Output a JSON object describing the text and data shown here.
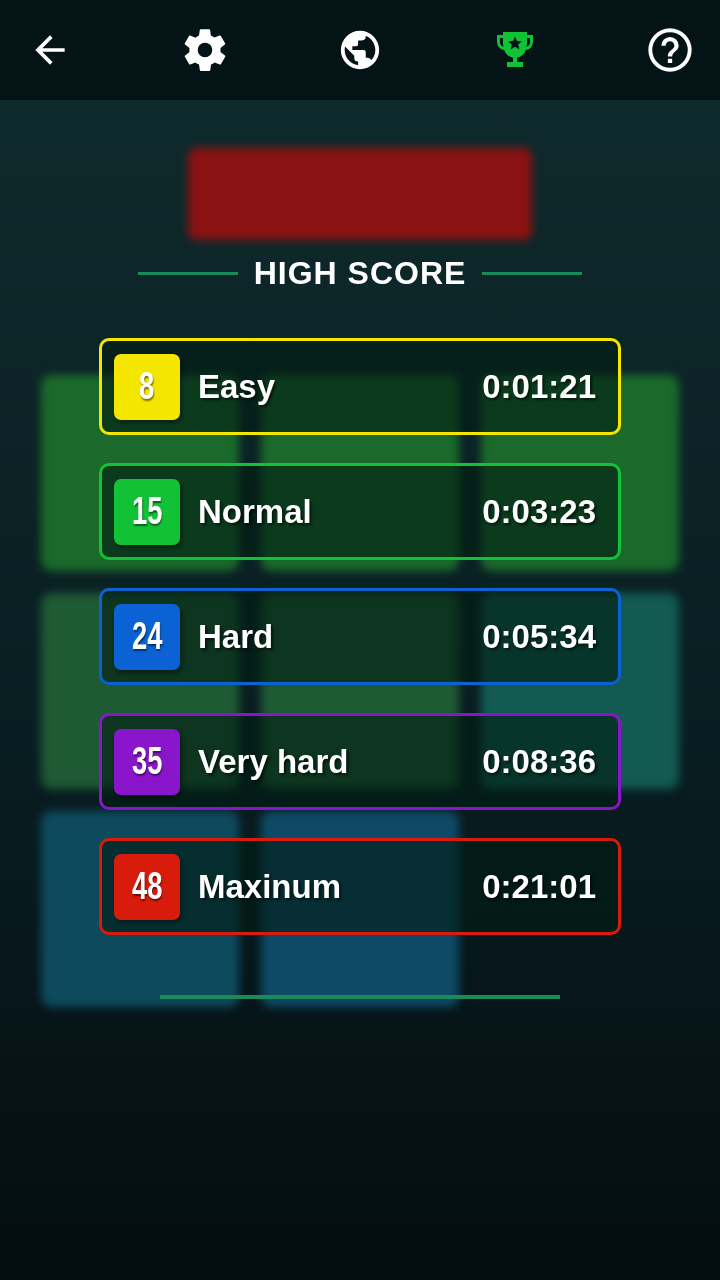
{
  "toolbar": [
    {
      "kind": "back",
      "selected": false
    },
    {
      "kind": "settings",
      "selected": false
    },
    {
      "kind": "globe",
      "selected": false
    },
    {
      "kind": "trophy",
      "selected": true
    },
    {
      "kind": "help",
      "selected": false
    }
  ],
  "background": {
    "tiles": [
      {
        "color": "#1b6a2c"
      },
      {
        "color": "#1b6a2c"
      },
      {
        "color": "#1b6a2c"
      },
      {
        "color": "#1e5a34"
      },
      {
        "color": "#1e5a34"
      },
      {
        "color": "#135a52"
      },
      {
        "color": "#0e4a5e"
      },
      {
        "color": "#0e4a66"
      }
    ]
  },
  "high_score": {
    "title": "HIGH SCORE",
    "rows": [
      {
        "count": "8",
        "level": "Easy",
        "time": "0:01:21",
        "color": "#f5e600"
      },
      {
        "count": "15",
        "level": "Normal",
        "time": "0:03:23",
        "color": "#12c236"
      },
      {
        "count": "24",
        "level": "Hard",
        "time": "0:05:34",
        "color": "#0a62d4"
      },
      {
        "count": "35",
        "level": "Very hard",
        "time": "0:08:36",
        "color": "#8a16cc"
      },
      {
        "count": "48",
        "level": "Maxinum",
        "time": "0:21:01",
        "color": "#d81c0c"
      }
    ]
  }
}
